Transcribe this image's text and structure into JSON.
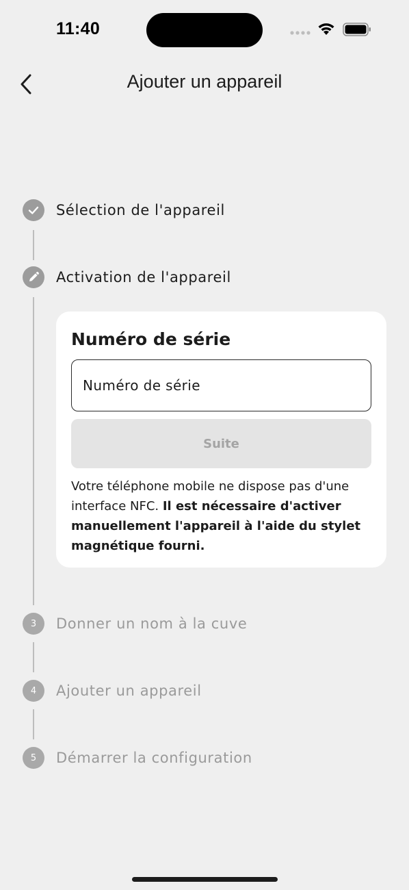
{
  "status_bar": {
    "time": "11:40"
  },
  "header": {
    "title": "Ajouter un appareil",
    "back_icon": "chevron-left-icon"
  },
  "steps": [
    {
      "label": "Sélection de l'appareil",
      "state": "done",
      "icon": "checkmark-icon"
    },
    {
      "label": "Activation de l'appareil",
      "state": "active",
      "icon": "pencil-icon"
    },
    {
      "label": "Donner un nom à la cuve",
      "state": "pending",
      "number": "3"
    },
    {
      "label": "Ajouter un appareil",
      "state": "pending",
      "number": "4"
    },
    {
      "label": "Démarrer la configuration",
      "state": "pending",
      "number": "5"
    }
  ],
  "card": {
    "title": "Numéro de série",
    "input_placeholder": "Numéro de série",
    "input_value": "",
    "button_label": "Suite",
    "info_text_regular": "Votre téléphone mobile ne dispose pas d'une interface NFC.",
    "info_text_bold": "Il est nécessaire d'activer manuellement l'appareil à l'aide du stylet magnétique fourni."
  },
  "colors": {
    "background": "#efefef",
    "card": "#ffffff",
    "step_circle": "#9c9c9c",
    "disabled_button": "#e4e4e4"
  }
}
